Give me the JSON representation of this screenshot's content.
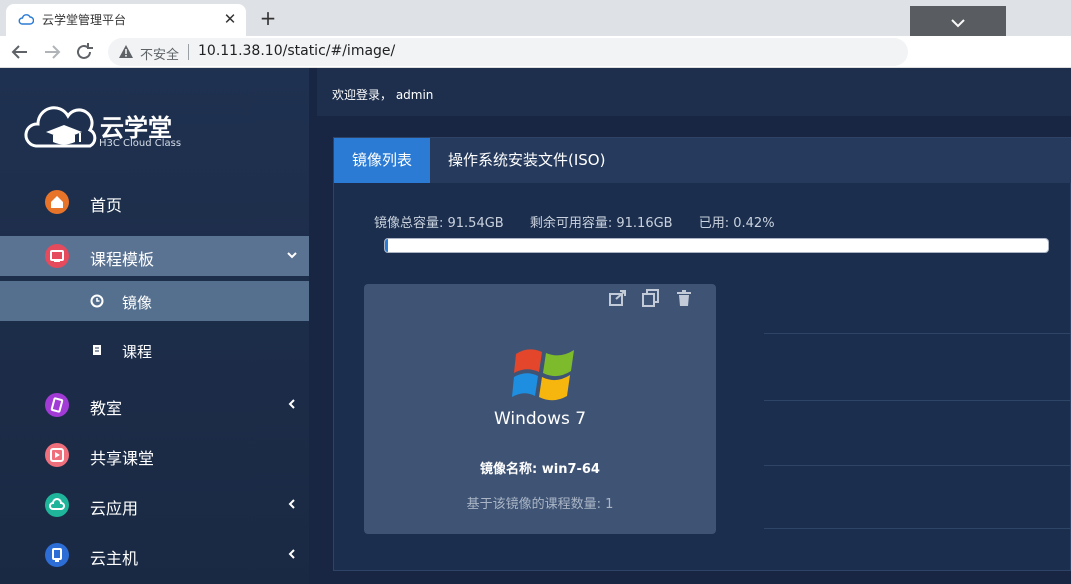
{
  "browser": {
    "tab_title": "云学堂管理平台",
    "close_glyph": "✕",
    "new_tab_glyph": "+",
    "security_label": "不安全",
    "url": "10.11.38.10/static/#/image/"
  },
  "brand": {
    "name": "云学堂",
    "subtitle": "H3C Cloud Class"
  },
  "sidebar": {
    "items": [
      {
        "label": "首页",
        "icon": "home-icon",
        "color": "#e8742a"
      },
      {
        "label": "课程模板",
        "icon": "template-icon",
        "color": "#e54b5c"
      },
      {
        "label": "教室",
        "icon": "classroom-icon",
        "color": "#a23bd6"
      },
      {
        "label": "共享课堂",
        "icon": "play-icon",
        "color": "#f06f7c"
      },
      {
        "label": "云应用",
        "icon": "cloud-app-icon",
        "color": "#1fb59a"
      },
      {
        "label": "云主机",
        "icon": "host-icon",
        "color": "#2d6ed6"
      }
    ],
    "submenu": [
      {
        "label": "镜像",
        "icon": "clock-icon"
      },
      {
        "label": "课程",
        "icon": "book-icon"
      }
    ]
  },
  "header": {
    "welcome": "欢迎登录， admin"
  },
  "panel": {
    "tabs": [
      "镜像列表",
      "操作系统安装文件(ISO)"
    ],
    "capacity": {
      "total": "镜像总容量: 91.54GB",
      "free": "剩余可用容量: 91.16GB",
      "used": "已用: 0.42%",
      "used_fraction": 0.0042
    }
  },
  "card": {
    "os_name": "Windows 7",
    "image_name": "镜像名称: win7-64",
    "course_count": "基于该镜像的课程数量: 1",
    "actions": [
      "export-icon",
      "copy-icon",
      "trash-icon"
    ]
  },
  "colors": {
    "accent": "#2b7bd4",
    "sidebar_bg": "#1f3150",
    "card_bg": "#3f5475"
  }
}
